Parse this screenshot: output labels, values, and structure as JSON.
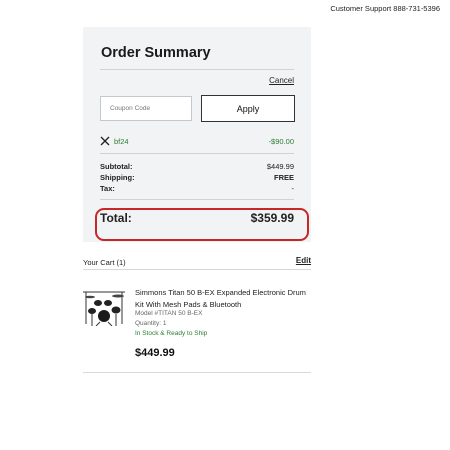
{
  "header": {
    "support_text": "Customer Support 888-731-5396"
  },
  "order_summary": {
    "title": "Order Summary",
    "cancel_label": "Cancel",
    "coupon_placeholder": "Coupon Code",
    "apply_label": "Apply",
    "applied_promo": {
      "icon": "close-icon",
      "code": "bf24",
      "amount": "-$90.00"
    },
    "rows": [
      {
        "label": "Subtotal:",
        "value": "$449.99"
      },
      {
        "label": "Shipping:",
        "value": "FREE"
      },
      {
        "label": "Tax:",
        "value": "-"
      }
    ],
    "total_label": "Total:",
    "total_value": "$359.99",
    "highlight_color": "#c62828"
  },
  "cart": {
    "title": "Your Cart (1)",
    "edit_label": "Edit",
    "items": [
      {
        "name": "Simmons Titan 50 B-EX Expanded Electronic Drum Kit With Mesh Pads & Bluetooth",
        "model": "Model #TITAN 50 B-EX",
        "quantity": "Quantity: 1",
        "stock": "In Stock & Ready to Ship",
        "price": "$449.99",
        "image_icon": "drum-kit-icon"
      }
    ]
  },
  "colors": {
    "panel_bg": "#f2f3f5",
    "success_green": "#2e7d32"
  }
}
